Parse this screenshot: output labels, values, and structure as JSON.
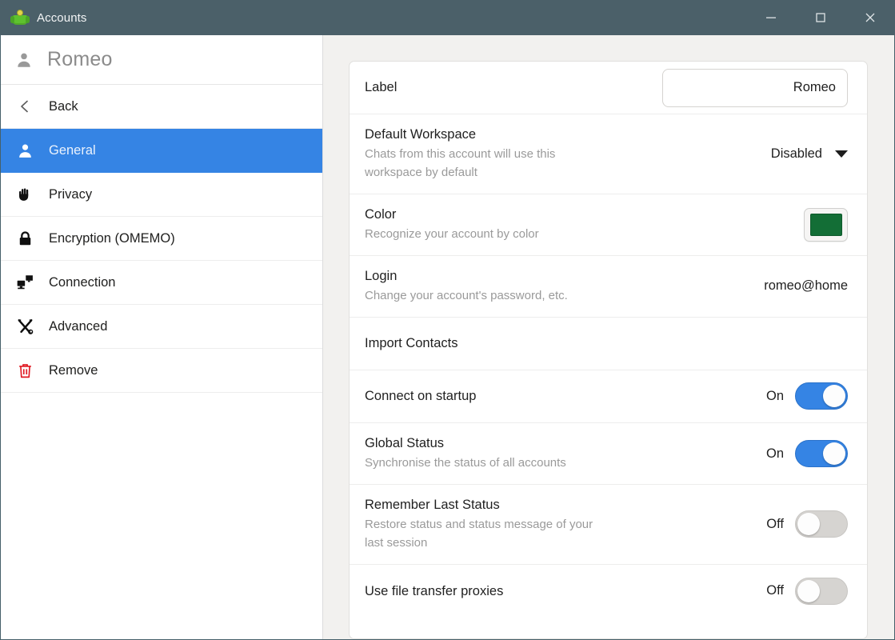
{
  "window": {
    "title": "Accounts",
    "app_icon": "dino-xmpp-icon",
    "titlebar_color": "#4b6069",
    "accent_color": "#3584e4",
    "controls": [
      {
        "name": "minimize-button",
        "icon": "minimize-icon"
      },
      {
        "name": "maximize-button",
        "icon": "maximize-icon"
      },
      {
        "name": "close-button",
        "icon": "close-icon"
      }
    ]
  },
  "sidebar": {
    "account_name": "Romeo",
    "account_icon": "person-icon",
    "items": [
      {
        "label": "Back",
        "icon": "chevron-left-icon",
        "selected": false,
        "key": "back"
      },
      {
        "label": "General",
        "icon": "person-icon",
        "selected": true,
        "key": "general"
      },
      {
        "label": "Privacy",
        "icon": "hand-icon",
        "selected": false,
        "key": "privacy"
      },
      {
        "label": "Encryption (OMEMO)",
        "icon": "lock-icon",
        "selected": false,
        "key": "encryption"
      },
      {
        "label": "Connection",
        "icon": "network-icon",
        "selected": false,
        "key": "connection"
      },
      {
        "label": "Advanced",
        "icon": "tools-icon",
        "selected": false,
        "key": "advanced"
      },
      {
        "label": "Remove",
        "icon": "trash-icon",
        "selected": false,
        "key": "remove"
      }
    ]
  },
  "settings": {
    "label": {
      "title": "Label",
      "value": "Romeo"
    },
    "default_workspace": {
      "title": "Default Workspace",
      "subtitle": "Chats from this account will use this workspace by default",
      "value": "Disabled"
    },
    "color": {
      "title": "Color",
      "subtitle": "Recognize your account by color",
      "value": "#136e36"
    },
    "login": {
      "title": "Login",
      "subtitle": "Change your account's password, etc.",
      "value": "romeo@home"
    },
    "import_contacts": {
      "title": "Import Contacts"
    },
    "connect_on_startup": {
      "title": "Connect on startup",
      "state": "On"
    },
    "global_status": {
      "title": "Global Status",
      "subtitle": "Synchronise the status of all accounts",
      "state": "On"
    },
    "remember_last_status": {
      "title": "Remember Last Status",
      "subtitle": "Restore status and status message of your last session",
      "state": "Off"
    },
    "file_transfer_proxies": {
      "title": "Use file transfer proxies",
      "state": "Off"
    }
  }
}
